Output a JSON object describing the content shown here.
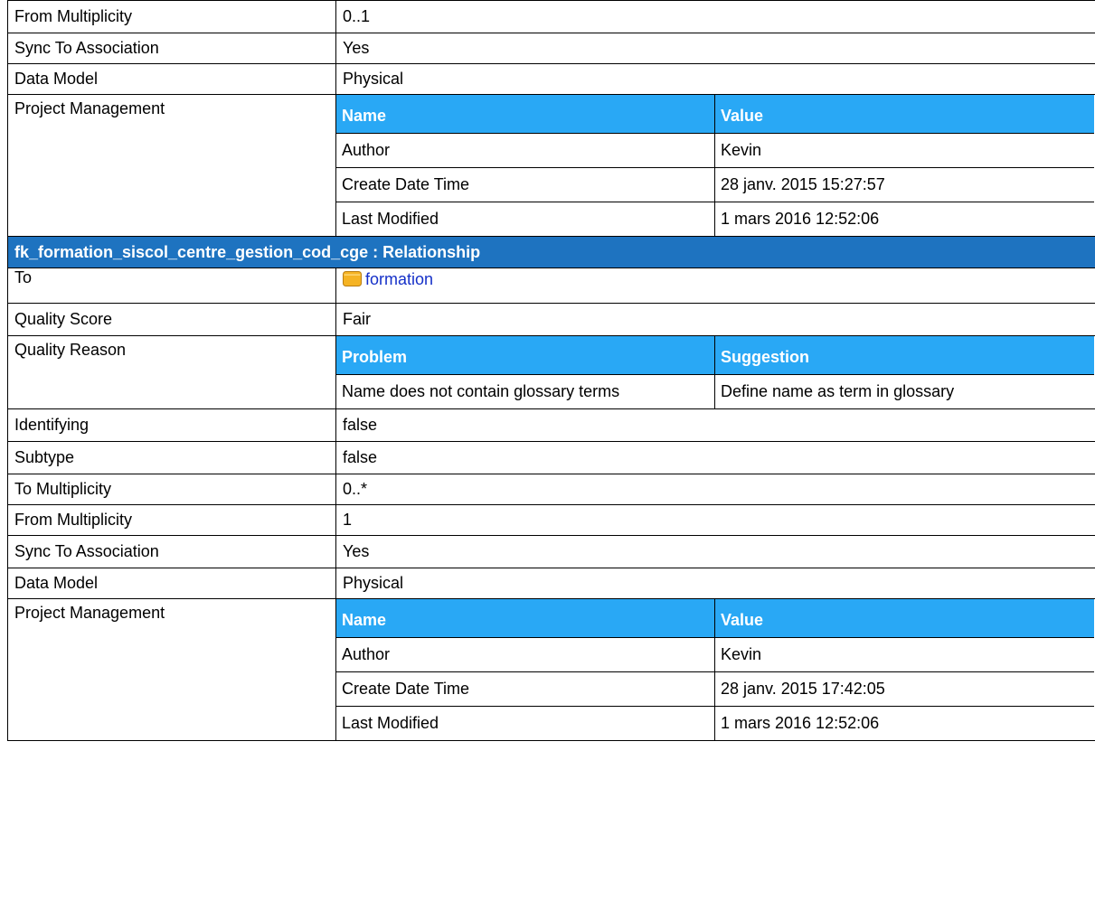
{
  "rows_top": [
    {
      "label": "From Multiplicity",
      "value": "0..1"
    },
    {
      "label": "Sync To Association",
      "value": "Yes"
    },
    {
      "label": "Data Model",
      "value": "Physical"
    }
  ],
  "pm1": {
    "label": "Project Management",
    "headers": [
      "Name",
      "Value"
    ],
    "rows": [
      [
        "Author",
        "Kevin"
      ],
      [
        "Create Date Time",
        "28 janv. 2015 15:27:57"
      ],
      [
        "Last Modified",
        "1 mars 2016 12:52:06"
      ]
    ]
  },
  "section": {
    "title": "fk_formation_siscol_centre_gestion_cod_cge : Relationship"
  },
  "to": {
    "label": "To",
    "link_text": "formation",
    "icon": "folder-icon",
    "icon_color": "#f5b323"
  },
  "quality_score": {
    "label": "Quality Score",
    "value": "Fair"
  },
  "quality_reason": {
    "label": "Quality Reason",
    "headers": [
      "Problem",
      "Suggestion"
    ],
    "rows": [
      [
        "Name does not contain glossary terms",
        "Define name as term in glossary"
      ]
    ]
  },
  "rows_bottom": [
    {
      "label": "Identifying",
      "value": "false"
    },
    {
      "label": "Subtype",
      "value": "false"
    },
    {
      "label": "To Multiplicity",
      "value": "0..*"
    },
    {
      "label": "From Multiplicity",
      "value": "1"
    },
    {
      "label": "Sync To Association",
      "value": "Yes"
    },
    {
      "label": "Data Model",
      "value": "Physical"
    }
  ],
  "pm2": {
    "label": "Project Management",
    "headers": [
      "Name",
      "Value"
    ],
    "rows": [
      [
        "Author",
        "Kevin"
      ],
      [
        "Create Date Time",
        "28 janv. 2015 17:42:05"
      ],
      [
        "Last Modified",
        "1 mars 2016 12:52:06"
      ]
    ]
  },
  "colors": {
    "section_header": "#1e73c0",
    "sub_header": "#29a8f5",
    "link": "#1530c8"
  }
}
